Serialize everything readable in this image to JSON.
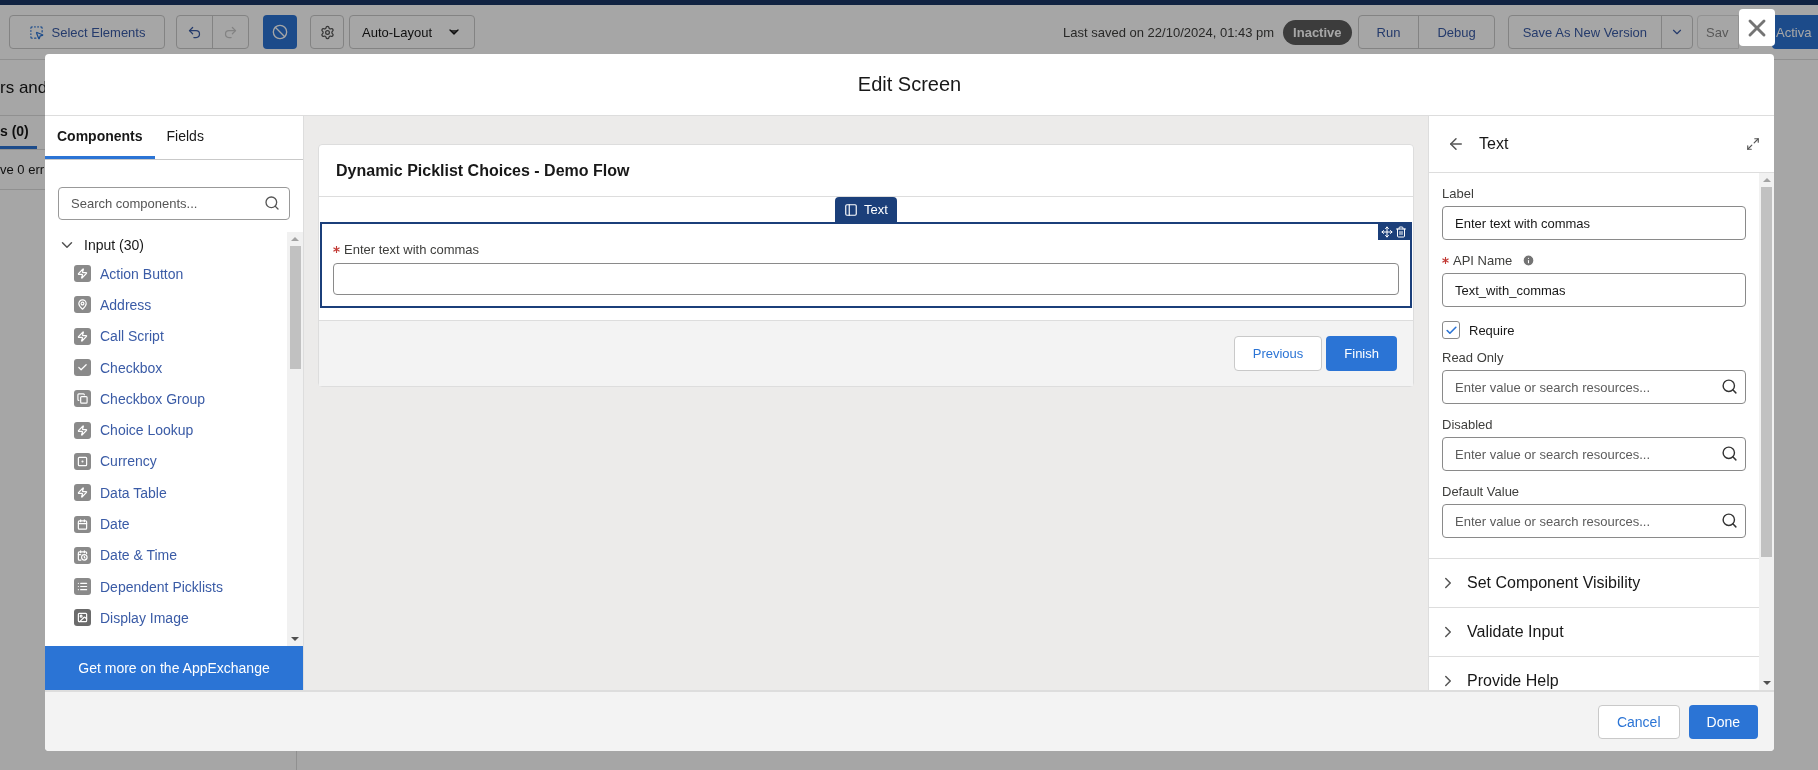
{
  "app_toolbar": {
    "select_button": "Select Elements",
    "layout_dropdown": "Auto-Layout",
    "last_saved": "Last saved on 22/10/2024, 01:43 pm",
    "status_badge": "Inactive",
    "run_buttons": [
      "Run",
      "Debug"
    ],
    "save_version": "Save As New Version",
    "save_button": {
      "label": "Sav",
      "disabled": true
    },
    "activate_button": "Activa"
  },
  "background_panel": {
    "title": "rs and",
    "tab": {
      "label": "s (0)",
      "selected": true
    },
    "message": "ve 0 err"
  },
  "modal": {
    "title": "Edit Screen",
    "palette": {
      "tabs": [
        {
          "label": "Components",
          "selected": true
        },
        {
          "label": "Fields",
          "selected": false
        }
      ],
      "search": {
        "placeholder": "Search components..."
      },
      "group": {
        "label": "Input (30)",
        "expanded": true,
        "items": [
          {
            "label": "Action Button",
            "kind": "bolt"
          },
          {
            "label": "Address",
            "kind": "pin"
          },
          {
            "label": "Call Script",
            "kind": "bolt"
          },
          {
            "label": "Checkbox",
            "kind": "check"
          },
          {
            "label": "Checkbox Group",
            "kind": "group"
          },
          {
            "label": "Choice Lookup",
            "kind": "bolt"
          },
          {
            "label": "Currency",
            "kind": "currency"
          },
          {
            "label": "Data Table",
            "kind": "bolt"
          },
          {
            "label": "Date",
            "kind": "calendar"
          },
          {
            "label": "Date & Time",
            "kind": "calendar-clock"
          },
          {
            "label": "Dependent Picklists",
            "kind": "list"
          },
          {
            "label": "Display Image",
            "kind": "image"
          }
        ]
      },
      "footer_link": "Get more on the AppExchange"
    },
    "canvas": {
      "screen_title": "Dynamic Picklist Choices - Demo Flow",
      "selected_component": "Text",
      "field": {
        "label": "Enter text with commas",
        "required": true
      },
      "buttons": [
        "Previous",
        "Finish"
      ]
    },
    "properties": {
      "title": "Text",
      "label_field": {
        "label": "Label",
        "value": "Enter text with commas"
      },
      "api_name": {
        "label": "API Name",
        "required": true,
        "value": "Text_with_commas"
      },
      "require": {
        "label": "Require",
        "checked": true
      },
      "resource_fields": [
        {
          "label": "Read Only",
          "placeholder": "Enter value or search resources..."
        },
        {
          "label": "Disabled",
          "placeholder": "Enter value or search resources..."
        },
        {
          "label": "Default Value",
          "placeholder": "Enter value or search resources..."
        }
      ],
      "sections": [
        {
          "label": "Set Component Visibility",
          "expanded": false
        },
        {
          "label": "Validate Input",
          "expanded": false
        },
        {
          "label": "Provide Help",
          "expanded": false
        }
      ]
    },
    "buttons": {
      "cancel": "Cancel",
      "done": "Done"
    }
  }
}
